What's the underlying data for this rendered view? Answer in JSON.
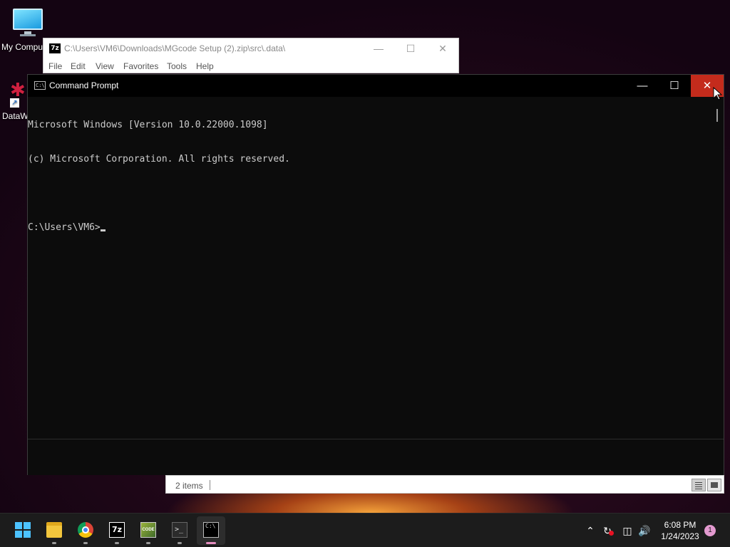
{
  "desktop": {
    "icons": [
      {
        "label": "My Compu"
      },
      {
        "label": "DataW"
      }
    ]
  },
  "zip_window": {
    "path": "C:\\Users\\VM6\\Downloads\\MGcode Setup (2).zip\\src\\.data\\",
    "app_icon_text": "7z",
    "menu": [
      "File",
      "Edit",
      "View",
      "Favorites",
      "Tools",
      "Help"
    ],
    "status_items": "2 items"
  },
  "cmd_window": {
    "title": "Command Prompt",
    "icon_text": "C:\\",
    "lines": [
      "Microsoft Windows [Version 10.0.22000.1098]",
      "(c) Microsoft Corporation. All rights reserved.",
      "",
      "C:\\Users\\VM6>"
    ]
  },
  "taskbar": {
    "apps": [
      {
        "name": "start",
        "icon": "windows-logo-icon"
      },
      {
        "name": "file-explorer",
        "icon": "folder-icon"
      },
      {
        "name": "chrome",
        "icon": "chrome-icon"
      },
      {
        "name": "7-zip",
        "icon": "7zip-icon",
        "text": "7z"
      },
      {
        "name": "mgcode",
        "icon": "code-app-icon",
        "text": "CODE"
      },
      {
        "name": "terminal",
        "icon": "terminal-icon",
        "text": ">_"
      },
      {
        "name": "command-prompt",
        "icon": "cmd-icon",
        "text": "C:\\"
      }
    ],
    "time": "6:08 PM",
    "date": "1/24/2023",
    "notification_count": "1"
  },
  "colors": {
    "close_hover": "#c42b1c",
    "console_bg": "#0c0c0c",
    "console_text": "#cccccc",
    "accent": "#4cc2ff"
  }
}
